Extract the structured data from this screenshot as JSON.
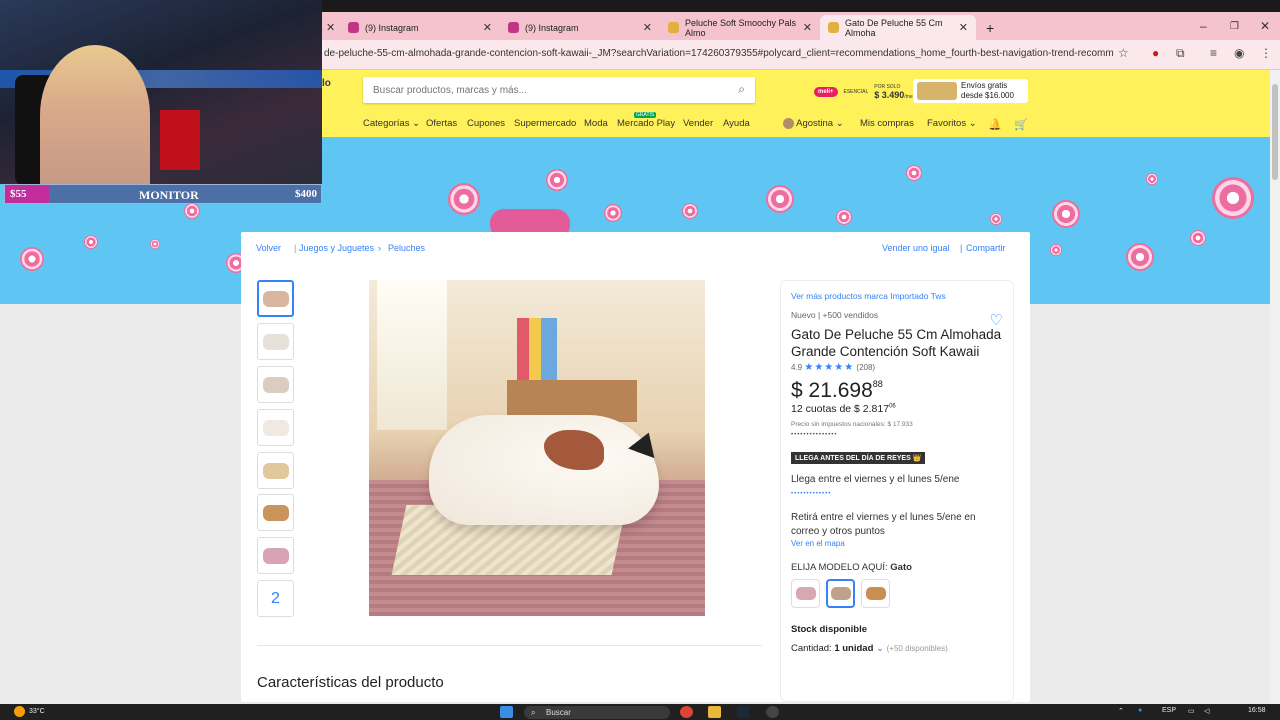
{
  "browser": {
    "tabs": [
      {
        "label": "(9) Instagram",
        "color": "#c13584"
      },
      {
        "label": "(9) Instagram",
        "color": "#c13584"
      },
      {
        "label": "Peluche Soft Smoochy Pals Almo",
        "color": "#e0b040"
      },
      {
        "label": "Gato De Peluche 55 Cm Almoha",
        "color": "#e0b040"
      }
    ],
    "new_tab": "+",
    "url": "de-peluche-55-cm-almohada-grande-contencion-soft-kawaii-_JM?searchVariation=174260379355#polycard_client=recommendations_home_fourth-best-navigation-trend-recommendation..."
  },
  "header": {
    "logo_fragment": "lo",
    "search_placeholder": "Buscar productos, marcas y más...",
    "nav": [
      "Categorías",
      "Ofertas",
      "Cupones",
      "Supermercado",
      "Moda",
      "Mercado Play",
      "Vender",
      "Ayuda"
    ],
    "mercado_play_badge": "GRATIS",
    "user": "Agostina",
    "user_links": [
      "Mis compras",
      "Favoritos"
    ],
    "promo_meli": "meli+",
    "promo_meli_sub": "ESENCIAL",
    "promo_price_label": "POR SOLO",
    "promo_price": "$ 3.490",
    "promo_price_suffix": "/mes",
    "shipping_line1": "Envíos gratis",
    "shipping_line2": "desde $16.000"
  },
  "stream": {
    "money_left": "$55",
    "title": "MONITOR",
    "money_right": "$400",
    "progress": 0.13
  },
  "breadcrumb": {
    "back": "Volver",
    "items": [
      "Juegos y Juguetes",
      "Peluches"
    ],
    "sell_same": "Vender uno igual",
    "share": "Compartir"
  },
  "gallery": {
    "more_count": "2"
  },
  "product": {
    "brand_link": "Ver más productos marca Importado Tws",
    "condition": "Nuevo",
    "sold": "+500 vendidos",
    "title": "Gato De Peluche 55 Cm Almohada Grande Contención Soft Kawaii",
    "rating": "4.9",
    "stars": "★★★★★",
    "reviews": "(208)",
    "price_symbol": "$",
    "price_int": "21.698",
    "price_cents": "88",
    "installments": "12 cuotas de $ 2.817",
    "installments_cents": "06",
    "tax_note": "Precio sin impuestos nacionales: $ 17.933",
    "more_methods": "•••••••••••••••",
    "badge": "LLEGA ANTES DEL DÍA DE REYES 👑",
    "delivery": "Llega entre el viernes y el lunes 5/ene",
    "delivery_link": "•••••••••••••",
    "pickup": "Retirá entre el viernes y el lunes 5/ene en correo y otros puntos",
    "map_link": "Ver en el mapa",
    "model_label": "ELIJA MODELO AQUÍ:",
    "model_value": "Gato",
    "stock": "Stock disponible",
    "quantity_label": "Cantidad:",
    "quantity_value": "1 unidad",
    "available": "(+50 disponibles)"
  },
  "characteristics_title": "Características del producto",
  "taskbar": {
    "temp": "33°C",
    "search": "Buscar",
    "lang": "ESP",
    "time": "16:58"
  }
}
